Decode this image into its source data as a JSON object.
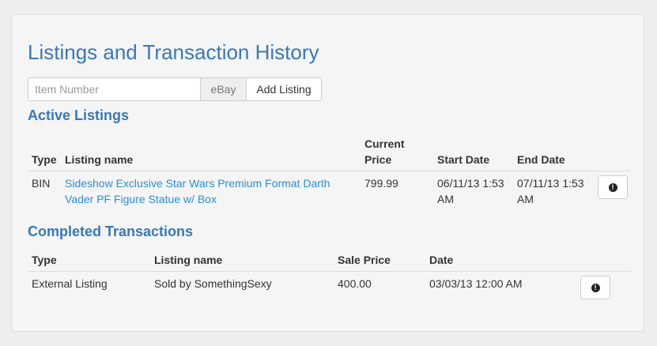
{
  "page": {
    "title": "Listings and Transaction History"
  },
  "add_listing": {
    "placeholder": "Item Number",
    "addon": "eBay",
    "button_label": "Add Listing"
  },
  "active": {
    "title": "Active Listings",
    "headers": [
      "Type",
      "Listing name",
      "Current Price",
      "Start Date",
      "End Date"
    ],
    "rows": [
      {
        "type": "BIN",
        "name": "Sideshow Exclusive Star Wars Premium Format Darth Vader PF Figure Statue w/ Box",
        "price": "799.99",
        "start": "06/11/13 1:53 AM",
        "end": "07/11/13 1:53 AM",
        "action_icon": "exclamation-circle-icon"
      }
    ]
  },
  "completed": {
    "title": "Completed Transactions",
    "headers": [
      "Type",
      "Listing name",
      "Sale Price",
      "Date"
    ],
    "rows": [
      {
        "type": "External Listing",
        "name": "Sold by SomethingSexy",
        "price": "400.00",
        "date": "03/03/13 12:00 AM",
        "action_icon": "exclamation-circle-icon"
      }
    ]
  },
  "colors": {
    "heading": "#3a78b5",
    "link": "#2a8fcf",
    "panel_bg": "#f5f5f5",
    "page_bg": "#eeeeee"
  }
}
